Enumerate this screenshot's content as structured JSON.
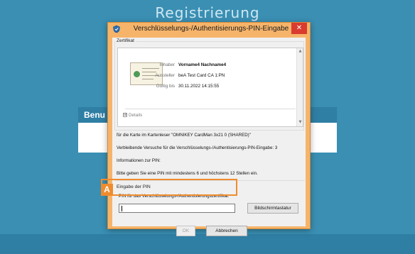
{
  "background": {
    "title": "Registrierung",
    "panel_title": "Benu"
  },
  "dialog": {
    "title": "Verschlüsselungs-/Authentisierungs-PIN-Eingabe",
    "close_label": "✕"
  },
  "certificate": {
    "group_label": "Zertifikat",
    "fields": [
      {
        "label": "Inhaber",
        "value": "Vorname4 Nachname4"
      },
      {
        "label": "Aussteller",
        "value": "beA Test Card CA 1:PN"
      },
      {
        "label": "Gültig bis",
        "value": "30.11.2022 14:15:55"
      }
    ],
    "details_label": "Details",
    "details_icon": "⊞"
  },
  "info": {
    "lines": [
      "für die Karte im Kartenleser \"OMNIKEY CardMan 3x21 0 (SHARED)\"",
      "Verbleibende Versuche für die Verschlüsselungs-/Authentisierungs-PIN-Eingabe: 3",
      "Informationen zur PIN:",
      "Bitte geben Sie eine PIN mit mindestens 6 und höchstens 12 Stellen ein."
    ]
  },
  "pin": {
    "group_label": "Eingabe der PIN",
    "field_label": "PIN für das Verschlüsselungs-/Authentisierungszertifikat:",
    "value": "",
    "keyboard_button": "Bildschirmtastatur"
  },
  "actions": {
    "ok": "OK",
    "cancel": "Abbrechen"
  },
  "annotation": {
    "badge": "A",
    "color": "#f08c2e"
  },
  "colors": {
    "background": "#3a8fb3",
    "dialog_frame": "#f6b46a",
    "close_button": "#d93b2e"
  },
  "icons": {
    "app": "shield-app-icon",
    "close": "close-icon",
    "certificate": "certificate-icon",
    "scroll_up": "scroll-up-arrow-icon",
    "scroll_down": "scroll-down-arrow-icon"
  }
}
